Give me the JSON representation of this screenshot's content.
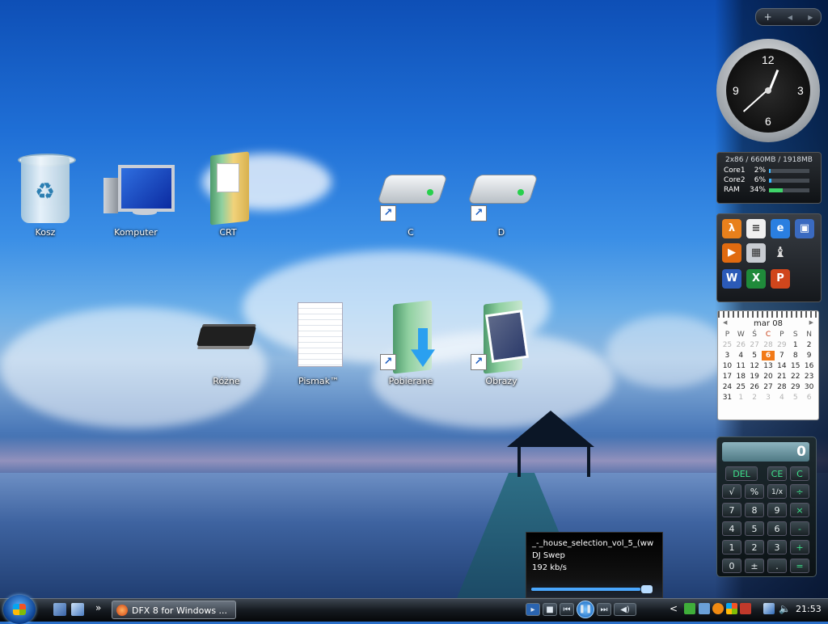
{
  "desktop": {
    "icons": [
      {
        "label": "Kosz"
      },
      {
        "label": "Komputer"
      },
      {
        "label": "CRT"
      },
      {
        "label": "C"
      },
      {
        "label": "D"
      },
      {
        "label": "Różne"
      },
      {
        "label": "Pismak™"
      },
      {
        "label": "Pobierane"
      },
      {
        "label": "Obrazy"
      }
    ],
    "shortcut_glyph": "↗"
  },
  "sidebar": {
    "toolbar": {
      "add": "+",
      "prev": "◀",
      "next": "▶"
    },
    "clock": {
      "n12": "12",
      "n3": "3",
      "n6": "6",
      "n9": "9",
      "hour_angle_deg": 22,
      "minute_angle_deg": 228
    },
    "perf": {
      "header": "2x86 / 660MB / 1918MB",
      "rows": [
        {
          "name": "Core1",
          "pct": "2%",
          "value": 0.02
        },
        {
          "name": "Core2",
          "pct": "6%",
          "value": 0.06
        },
        {
          "name": "RAM",
          "pct": "34%",
          "value": 0.34
        }
      ]
    },
    "launcher": {
      "apps": [
        "half-life-icon",
        "notes-icon",
        "ie-icon",
        "monitor-icon",
        "media-icon",
        "calculator-icon",
        "chess-icon",
        "word-icon",
        "excel-icon",
        "powerpoint-icon"
      ]
    },
    "calendar": {
      "month": "mar 08",
      "prev": "◀",
      "next": "▶",
      "dow": [
        "P",
        "W",
        "Ś",
        "C",
        "P",
        "S",
        "N"
      ],
      "days": [
        [
          "25",
          "26",
          "27",
          "28",
          "29",
          "1",
          "2"
        ],
        [
          "3",
          "4",
          "5",
          "6",
          "7",
          "8",
          "9"
        ],
        [
          "10",
          "11",
          "12",
          "13",
          "14",
          "15",
          "16"
        ],
        [
          "17",
          "18",
          "19",
          "20",
          "21",
          "22",
          "23"
        ],
        [
          "24",
          "25",
          "26",
          "27",
          "28",
          "29",
          "30"
        ],
        [
          "31",
          "1",
          "2",
          "3",
          "4",
          "5",
          "6"
        ]
      ]
    },
    "calculator": {
      "display": "0",
      "buttons": {
        "del": "DEL",
        "ce": "CE",
        "c": "C",
        "sqrt": "√",
        "pct": "%",
        "inv": "1/x",
        "div": "÷",
        "b7": "7",
        "b8": "8",
        "b9": "9",
        "mul": "×",
        "b4": "4",
        "b5": "5",
        "b6": "6",
        "sub": "-",
        "b1": "1",
        "b2": "2",
        "b3": "3",
        "add": "+",
        "b0": "0",
        "neg": "±",
        "dot": ".",
        "eq": "="
      }
    }
  },
  "media_popup": {
    "track": "_-_house_selection_vol_5_(ww",
    "artist": "DJ Swep",
    "bitrate": "192 kb/s",
    "progress": 0.9
  },
  "taskbar": {
    "quick_launch_more": "»",
    "task_button_label": "DFX 8 for Windows ...",
    "player": {
      "stop": "■",
      "prev": "⏮",
      "pause": "❚❚",
      "next": "⏭",
      "volume": "◀)"
    },
    "tray_expand": "<",
    "clock": "21:53"
  },
  "colors": {
    "accent": "#3ab6ff",
    "ram": "#3fd46a",
    "today": "#f27a18"
  }
}
